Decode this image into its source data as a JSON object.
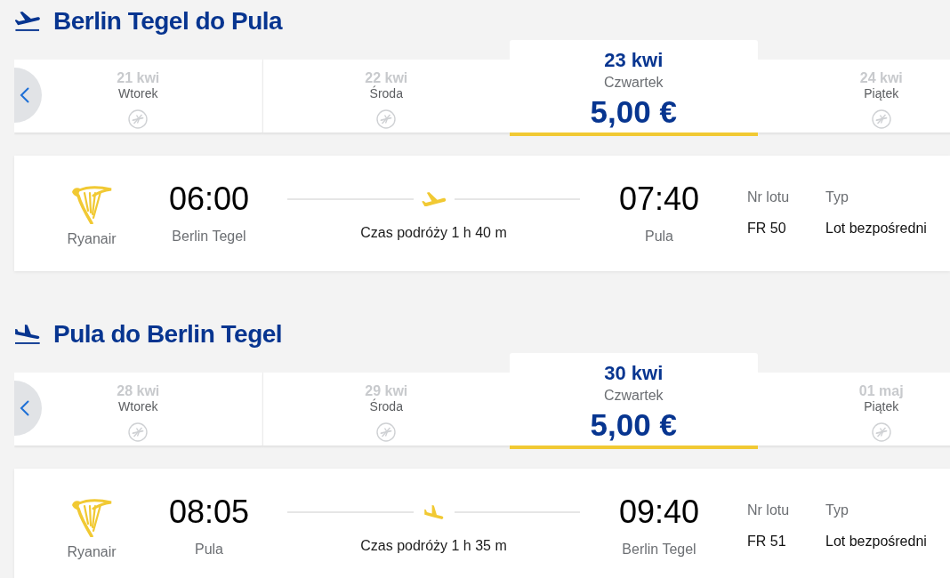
{
  "legs": [
    {
      "kind": "outbound",
      "title": "Berlin Tegel do Pula",
      "dates": [
        {
          "date": "21 kwi",
          "day": "Wtorek",
          "available": false,
          "selected": false
        },
        {
          "date": "22 kwi",
          "day": "Środa",
          "available": false,
          "selected": false
        },
        {
          "date": "23 kwi",
          "day": "Czwartek",
          "price": "5,00 €",
          "available": true,
          "selected": true
        },
        {
          "date": "24 kwi",
          "day": "Piątek",
          "available": false,
          "selected": false
        }
      ],
      "flight": {
        "airline": "Ryanair",
        "departure_time": "06:00",
        "departure_airport": "Berlin Tegel",
        "duration": "Czas podróży 1 h 40 m",
        "arrival_time": "07:40",
        "arrival_airport": "Pula",
        "flight_number_label": "Nr lotu",
        "flight_number": "FR 50",
        "type_label": "Typ",
        "type": "Lot bezpośredni"
      }
    },
    {
      "kind": "return",
      "title": "Pula do Berlin Tegel",
      "dates": [
        {
          "date": "28 kwi",
          "day": "Wtorek",
          "available": false,
          "selected": false
        },
        {
          "date": "29 kwi",
          "day": "Środa",
          "available": false,
          "selected": false
        },
        {
          "date": "30 kwi",
          "day": "Czwartek",
          "price": "5,00 €",
          "available": true,
          "selected": true
        },
        {
          "date": "01 maj",
          "day": "Piątek",
          "available": false,
          "selected": false
        }
      ],
      "flight": {
        "airline": "Ryanair",
        "departure_time": "08:05",
        "departure_airport": "Pula",
        "duration": "Czas podróży 1 h 35 m",
        "arrival_time": "09:40",
        "arrival_airport": "Berlin Tegel",
        "flight_number_label": "Nr lotu",
        "flight_number": "FR 51",
        "type_label": "Typ",
        "type": "Lot bezpośredni"
      }
    }
  ]
}
